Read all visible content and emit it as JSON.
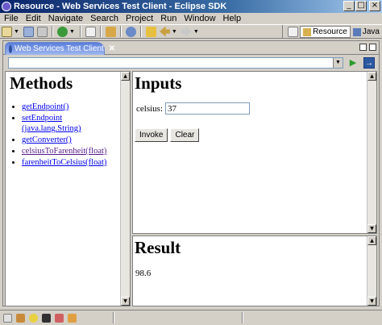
{
  "window": {
    "title": "Resource - Web Services Test Client - Eclipse SDK",
    "minimize_label": "_",
    "maximize_label": "□",
    "close_label": "×"
  },
  "menubar": {
    "items": [
      "File",
      "Edit",
      "Navigate",
      "Search",
      "Project",
      "Run",
      "Window",
      "Help"
    ]
  },
  "perspectives": {
    "resource_label": "Resource",
    "java_label": "Java"
  },
  "editor": {
    "tab_label": "Web Services Test Client",
    "tab_close": "✕",
    "url_value": "",
    "go_glyph": "▶",
    "nav_glyph": "→"
  },
  "methods": {
    "heading": "Methods",
    "items": [
      {
        "label": "getEndpoint()"
      },
      {
        "label": "setEndpoint (java.lang.String)"
      },
      {
        "label": "getConverter()"
      },
      {
        "label": "celsiusToFarenheit(float)"
      },
      {
        "label": "farenheitToCelsius(float)"
      }
    ]
  },
  "inputs": {
    "heading": "Inputs",
    "celsius_label": "celsius:",
    "celsius_value": "37",
    "invoke_label": "Invoke",
    "clear_label": "Clear"
  },
  "result": {
    "heading": "Result",
    "value": "98.6"
  },
  "colors": {
    "title_bar": "#0a246a",
    "link": "#0000ee",
    "visited_link": "#551a8b",
    "chrome": "#d4d0c8"
  }
}
